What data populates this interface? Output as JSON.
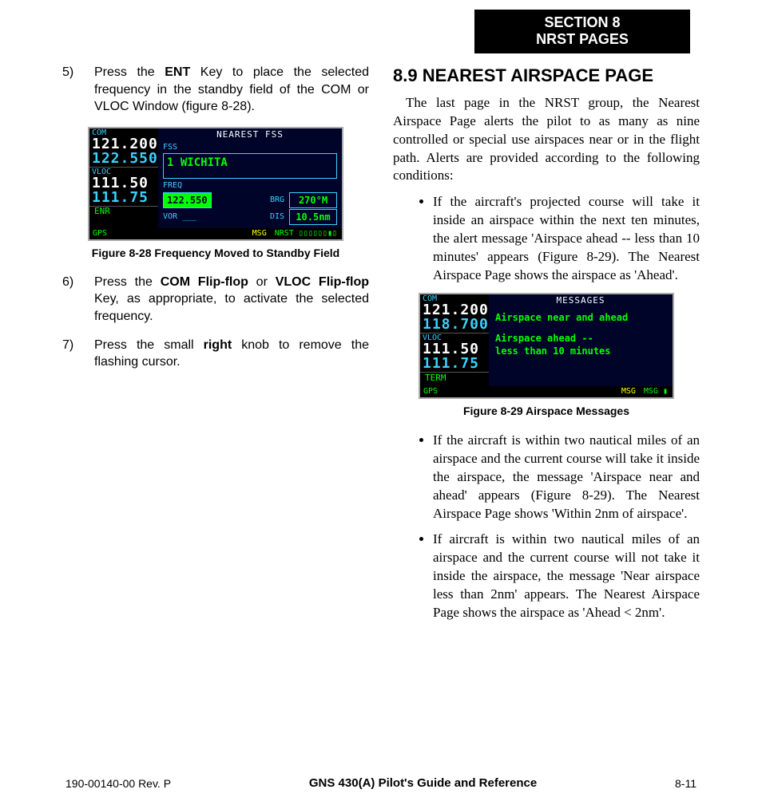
{
  "header": {
    "section_line1": "SECTION 8",
    "section_line2": "NRST PAGES"
  },
  "left_column": {
    "steps": {
      "5": {
        "num_label": "5)",
        "pre": "Press the ",
        "bold1": "ENT",
        "post": " Key to place the selected frequency in the standby field of the COM or VLOC Window (figure 8-28)."
      },
      "6": {
        "num_label": "6)",
        "pre": "Press the ",
        "bold1": "COM Flip-flop",
        "mid": " or ",
        "bold2": "VLOC Flip-flop",
        "post": " Key, as appropriate, to activate the selected frequency."
      },
      "7": {
        "num_label": "7)",
        "pre": "Press the small ",
        "bold1": "right",
        "post": " knob to remove the flashing cursor."
      }
    },
    "figure28": {
      "caption": "Figure 8-28  Frequency Moved to Standby Field",
      "left": {
        "com_label": "COM",
        "com_active": "121.200",
        "com_standby": "122.550",
        "vloc_label": "VLOC",
        "vloc_active": "111.50",
        "vloc_standby": "111.75",
        "mode": "ENR"
      },
      "right": {
        "title": "NEAREST FSS",
        "fss_label": "FSS",
        "fss_value": "1 WICHITA",
        "freq_label": "FREQ",
        "freq_value": "122.550",
        "vor_label": "VOR ___",
        "brg_label": "BRG",
        "brg_value": "270°M",
        "dis_label": "DIS",
        "dis_value": "10.5nm"
      },
      "bottom": {
        "left": "GPS",
        "mid": "MSG",
        "right": "NRST ▯▯▯▯▯▯▮▯"
      }
    }
  },
  "right_column": {
    "heading": "8.9  NEAREST AIRSPACE PAGE",
    "intro": "The last page in the NRST group, the Nearest Airspace Page alerts the pilot to as many as nine controlled or special use airspaces near or in the flight path.  Alerts are provided according to the following conditions:",
    "bullets": {
      "0": "If the aircraft's projected course will take it inside an airspace within the next ten minutes, the alert message 'Airspace ahead -- less than 10 minutes' appears (Figure 8-29).  The Nearest Airspace Page shows the airspace as 'Ahead'.",
      "1": "If the aircraft is within two nautical miles of an airspace and the current course will take it inside the airspace, the message 'Airspace near and ahead' appears (Figure 8-29).  The Nearest Airspace Page shows 'Within 2nm of airspace'.",
      "2": "If aircraft is within two nautical miles of an airspace and the current course will not take it inside the airspace, the message 'Near airspace less than 2nm' appears.  The Nearest Airspace Page shows the airspace as 'Ahead < 2nm'."
    },
    "figure29": {
      "caption": "Figure 8-29  Airspace Messages",
      "left": {
        "com_label": "COM",
        "com_active": "121.200",
        "com_standby": "118.700",
        "vloc_label": "VLOC",
        "vloc_active": "111.50",
        "vloc_standby": "111.75",
        "mode": "TERM"
      },
      "right": {
        "title": "MESSAGES",
        "msg1": "Airspace near and ahead",
        "msg2a": "Airspace ahead --",
        "msg2b": " less than 10 minutes"
      },
      "bottom": {
        "left": "GPS",
        "mid": "MSG",
        "right": "MSG ▮"
      }
    }
  },
  "footer": {
    "left": "190-00140-00  Rev. P",
    "mid": "GNS 430(A) Pilot's Guide and Reference",
    "right": "8-11"
  }
}
